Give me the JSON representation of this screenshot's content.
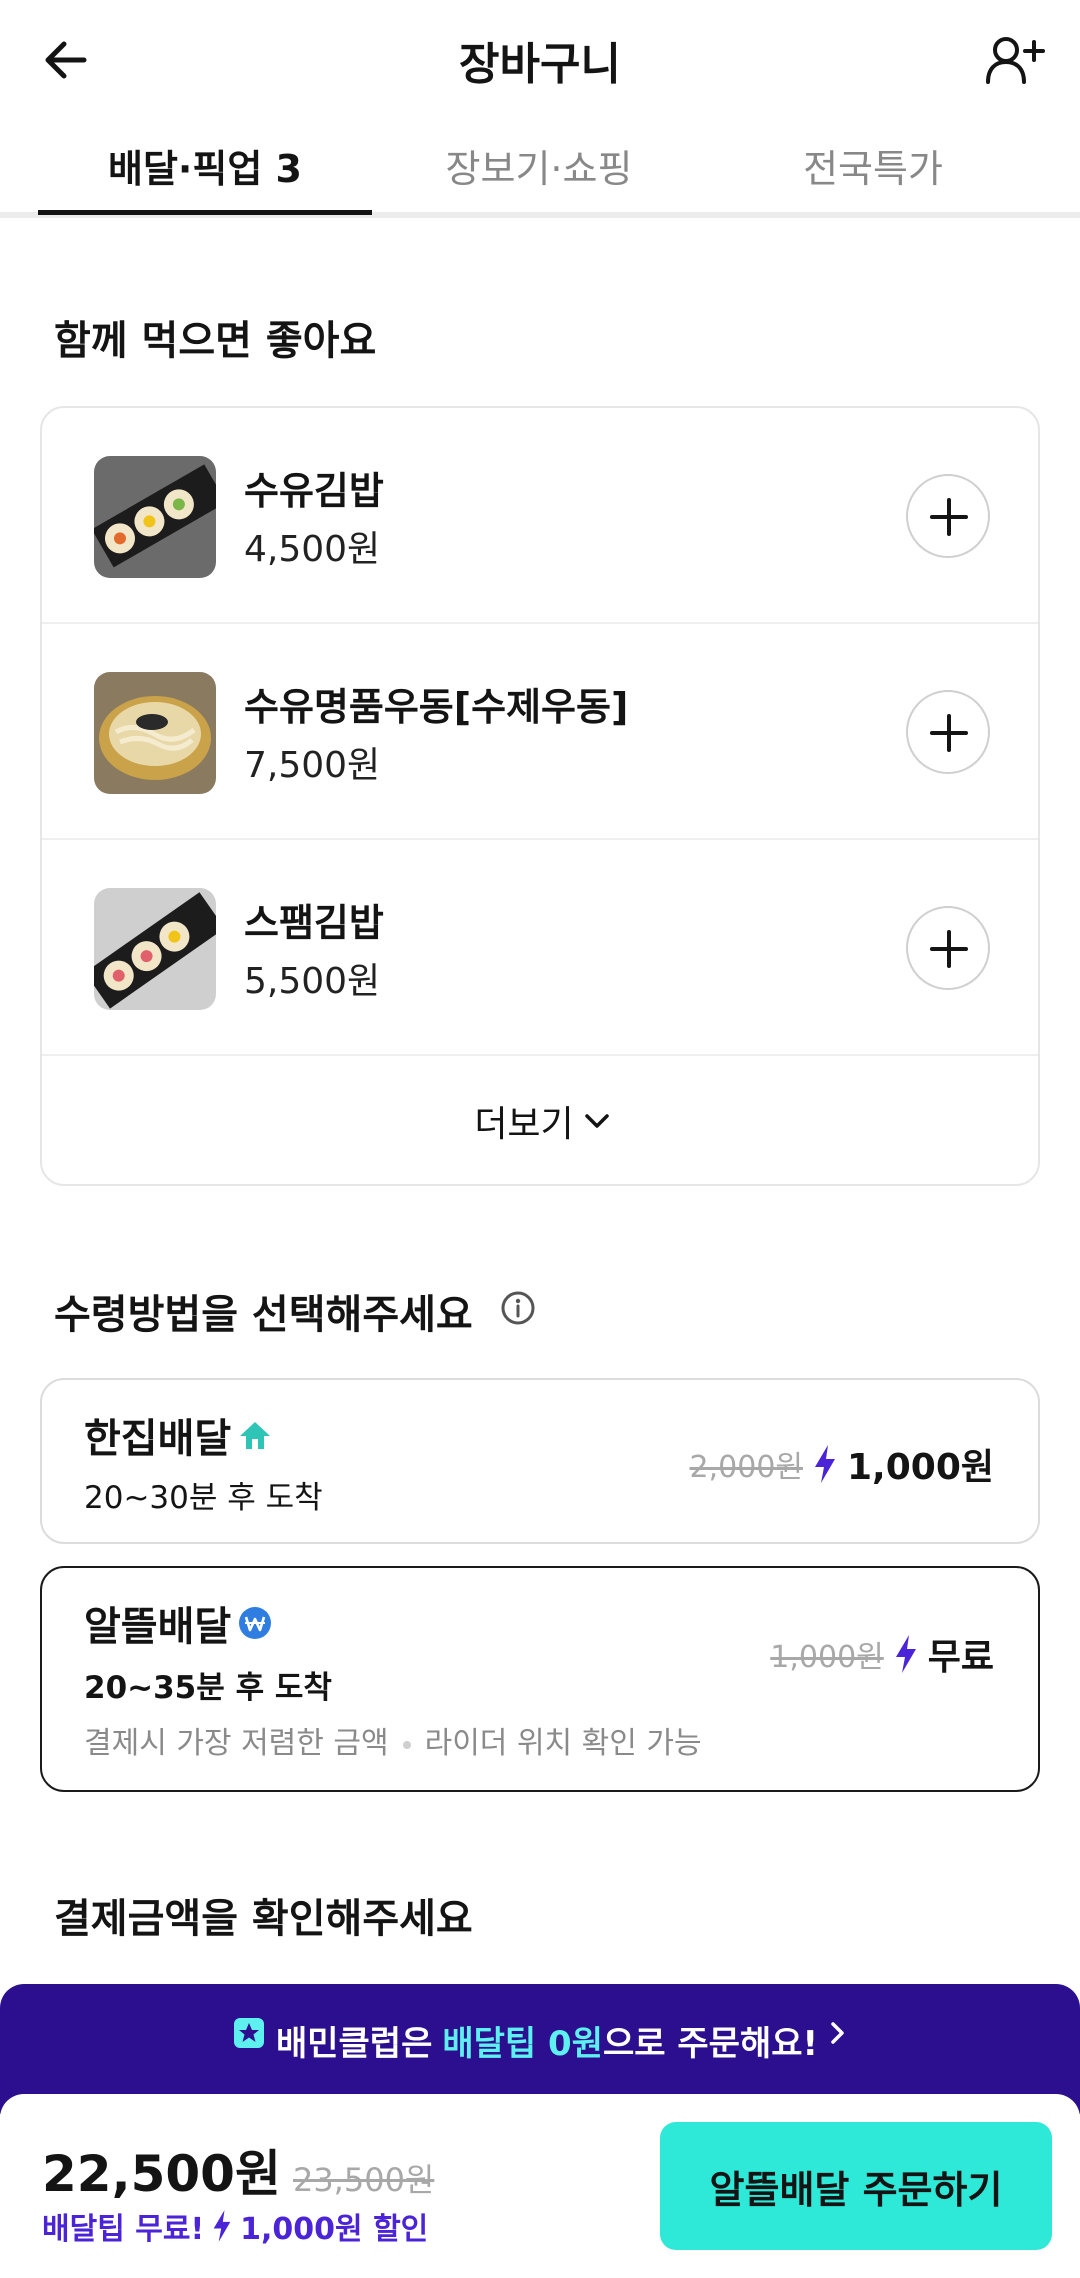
{
  "header": {
    "title": "장바구니"
  },
  "tabs": [
    {
      "label": "배달·픽업 3"
    },
    {
      "label": "장보기·쇼핑"
    },
    {
      "label": "전국특가"
    }
  ],
  "recommend": {
    "title": "함께 먹으면 좋아요",
    "items": [
      {
        "name": "수유김밥",
        "price": "4,500원"
      },
      {
        "name": "수유명품우동[수제우동]",
        "price": "7,500원"
      },
      {
        "name": "스팸김밥",
        "price": "5,500원"
      }
    ],
    "more_label": "더보기"
  },
  "delivery": {
    "title": "수령방법을 선택해주세요",
    "options": [
      {
        "name": "한집배달",
        "eta": "20~30분 후 도착",
        "original_fee": "2,000원",
        "fee": "1,000원"
      },
      {
        "name": "알뜰배달",
        "eta": "20~35분 후 도착",
        "original_fee": "1,000원",
        "fee": "무료",
        "desc_1": "결제시 가장 저렴한 금액",
        "desc_2": "라이더 위치 확인 가능"
      }
    ]
  },
  "payment": {
    "title": "결제금액을 확인해주세요"
  },
  "club_banner": {
    "part1": "배민클럽은",
    "highlight": "배달팁 0원",
    "part2": "으로 주문해요!"
  },
  "bottom": {
    "total": "22,500원",
    "original_total": "23,500원",
    "discount_1": "배달팁 무료!",
    "discount_2": "1,000원 할인",
    "order_button": "알뜰배달 주문하기"
  },
  "colors": {
    "accent": "#2ee8d8",
    "club_purple": "#2b0f8f",
    "discount_purple": "#4a24d6",
    "bolt": "#4a24d6"
  }
}
